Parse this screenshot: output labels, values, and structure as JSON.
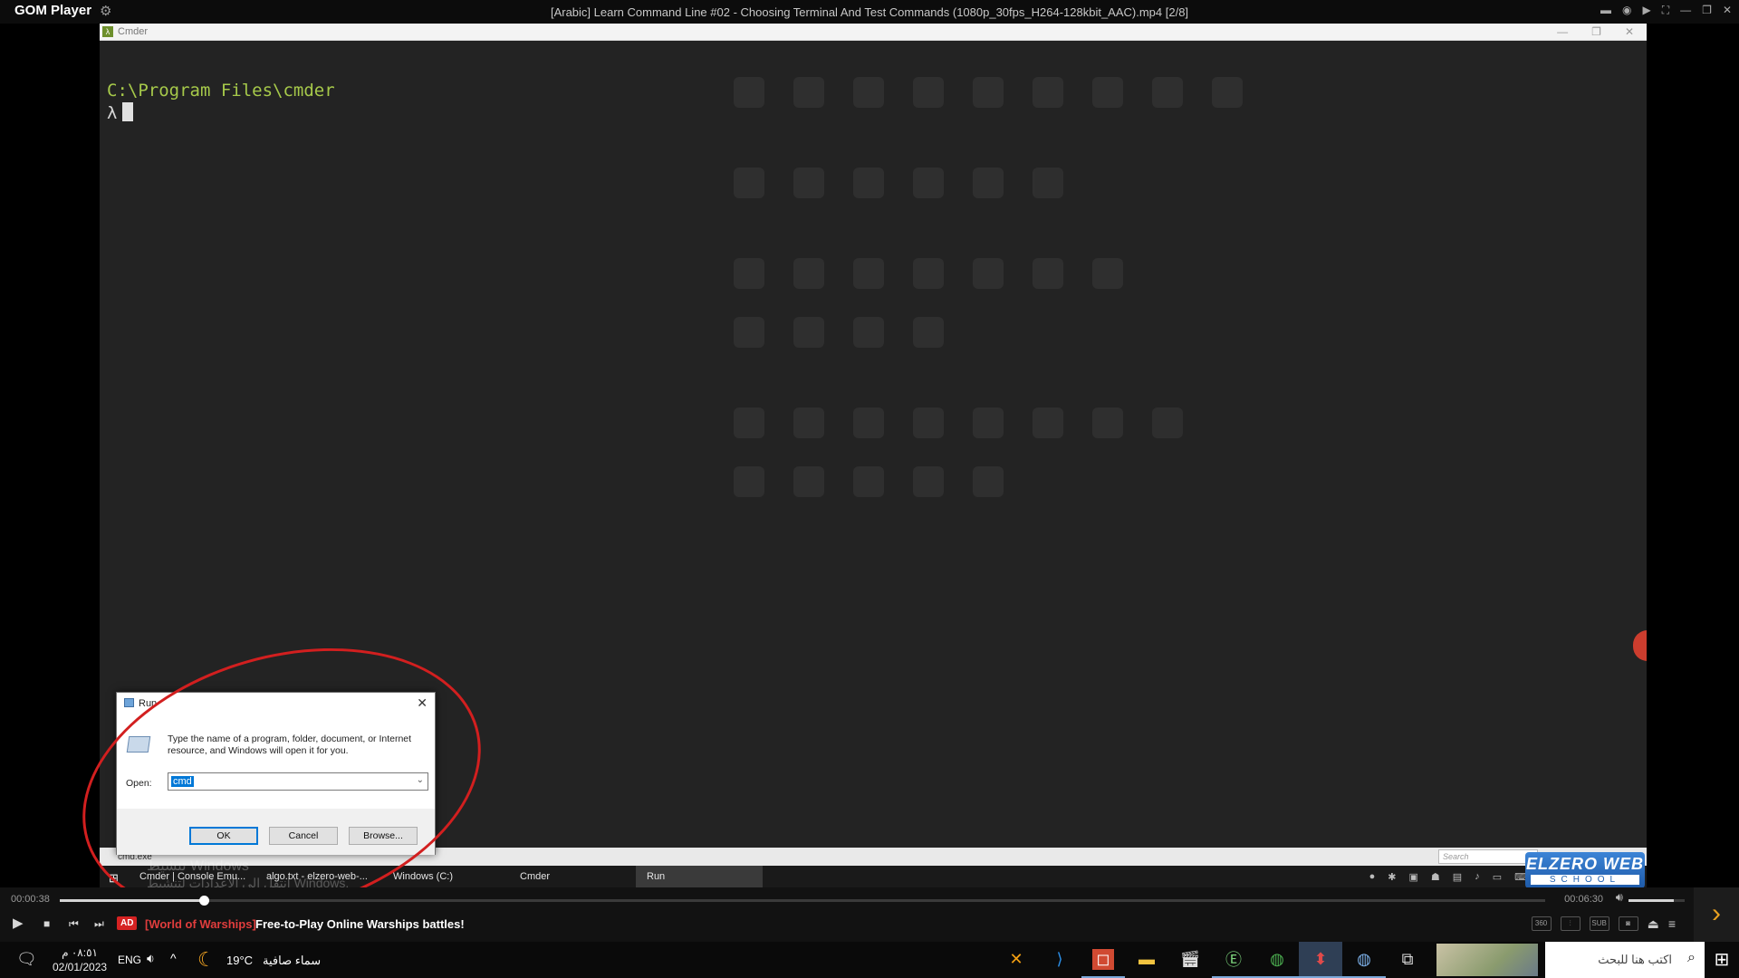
{
  "gom": {
    "app_name": "GOM Player",
    "window_title": "[Arabic] Learn Command Line #02 - Choosing Terminal And Test Commands (1080p_30fps_H264-128kbit_AAC).mp4  [2/8]"
  },
  "cmder": {
    "window_title": "Cmder",
    "path_line": "C:\\Program Files\\cmder",
    "prompt_symbol": "λ",
    "status_text": "cmd.exe",
    "search_placeholder": "Search"
  },
  "recorded_taskbar": {
    "items": [
      {
        "label": "Cmder | Console Emu..."
      },
      {
        "label": "algo.txt - elzero-web-..."
      },
      {
        "label": "Windows (C:)"
      },
      {
        "label": "Cmder"
      },
      {
        "label": "Run"
      }
    ],
    "watermark_line1": "تنشيط Windows",
    "watermark_line2": "انتقل إلى الإعدادات لتنشيط Windows."
  },
  "run_dialog": {
    "title": "Run",
    "description": "Type the name of a program, folder, document, or Internet resource, and Windows will open it for you.",
    "open_label": "Open:",
    "input_value": "cmd",
    "ok_label": "OK",
    "cancel_label": "Cancel",
    "browse_label": "Browse..."
  },
  "brand_badge": {
    "line1": "ELZERO WEB",
    "line2": "SCHOOL"
  },
  "player": {
    "elapsed": "00:00:38",
    "duration": "00:06:30",
    "progress": 0.097,
    "volume": 0.8,
    "ad_badge": "AD",
    "ad_brand": "[World of Warships]",
    "ad_text": "Free-to-Play Online Warships battles!"
  },
  "windows_taskbar": {
    "time": "٠٨:٥١ م",
    "date": "02/01/2023",
    "language": "ENG",
    "temperature": "19°C",
    "weather": "سماء صافية",
    "search_placeholder": "اكتب هنا للبحث",
    "pinned_apps": [
      "xampp-icon",
      "vscode-icon",
      "office-icon",
      "file-explorer-icon",
      "video-editor-icon",
      "ide-icon",
      "chrome-icon",
      "git-icon",
      "chrome-dev-icon",
      "task-view-icon"
    ]
  },
  "colors": {
    "prompt_path": "#a6c94a",
    "annotation": "#d21f1f",
    "ad_red": "#d62222",
    "accent_orange": "#e8a020"
  }
}
